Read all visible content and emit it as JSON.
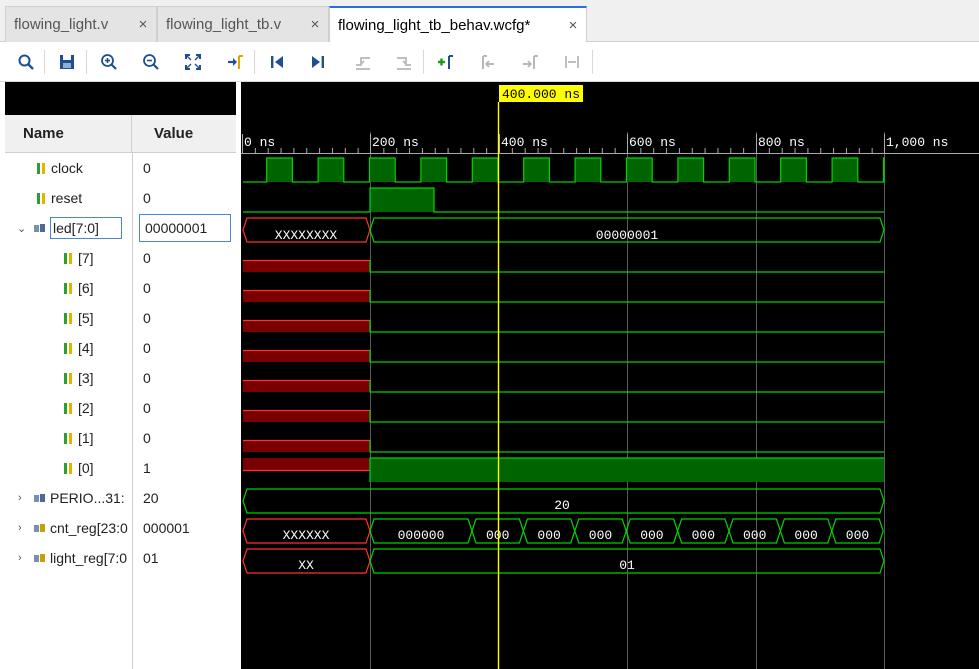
{
  "tabs": [
    {
      "label": "flowing_light.v"
    },
    {
      "label": "flowing_light_tb.v"
    },
    {
      "label": "flowing_light_tb_behav.wcfg*"
    }
  ],
  "tab_close": "×",
  "cursor_time": "400.000 ns",
  "columns": {
    "name": "Name",
    "value": "Value"
  },
  "time_ticks": [
    "0 ns",
    "200 ns",
    "400 ns",
    "600 ns",
    "800 ns",
    "1,000 ns"
  ],
  "signals": [
    {
      "name": "clock",
      "value": "0"
    },
    {
      "name": "reset",
      "value": "0"
    },
    {
      "name": "led[7:0]",
      "value": "00000001"
    },
    {
      "name": "[7]",
      "value": "0"
    },
    {
      "name": "[6]",
      "value": "0"
    },
    {
      "name": "[5]",
      "value": "0"
    },
    {
      "name": "[4]",
      "value": "0"
    },
    {
      "name": "[3]",
      "value": "0"
    },
    {
      "name": "[2]",
      "value": "0"
    },
    {
      "name": "[1]",
      "value": "0"
    },
    {
      "name": "[0]",
      "value": "1"
    },
    {
      "name": "PERIO...31:",
      "value": "20"
    },
    {
      "name": "cnt_reg[23:0",
      "value": "000001"
    },
    {
      "name": "light_reg[7:0",
      "value": "01"
    }
  ],
  "bus_labels": {
    "led_x": "XXXXXXXX",
    "led_val": "00000001",
    "period_val": "20",
    "cnt_x": "XXXXXX",
    "cnt_first": "000000",
    "cnt_segments": [
      "000",
      "000",
      "000",
      "000",
      "000",
      "000",
      "000",
      "000"
    ],
    "light_x": "XX",
    "light_val": "01"
  },
  "colors": {
    "wave_bg": "#000000",
    "signal": "#00d400",
    "fill": "#006400",
    "undefined": "#ff3030",
    "cursor": "#ffff00",
    "tab_accent": "#2a6fd8"
  },
  "icons": [
    "search-icon",
    "save-icon",
    "zoom-in-icon",
    "zoom-out-icon",
    "zoom-fit-icon",
    "go-to-cursor-icon",
    "go-to-time-0-icon",
    "go-to-last-time-icon",
    "previous-transition-icon",
    "next-transition-icon",
    "add-marker-icon",
    "previous-marker-icon",
    "next-marker-icon",
    "swap-cursors-icon"
  ]
}
